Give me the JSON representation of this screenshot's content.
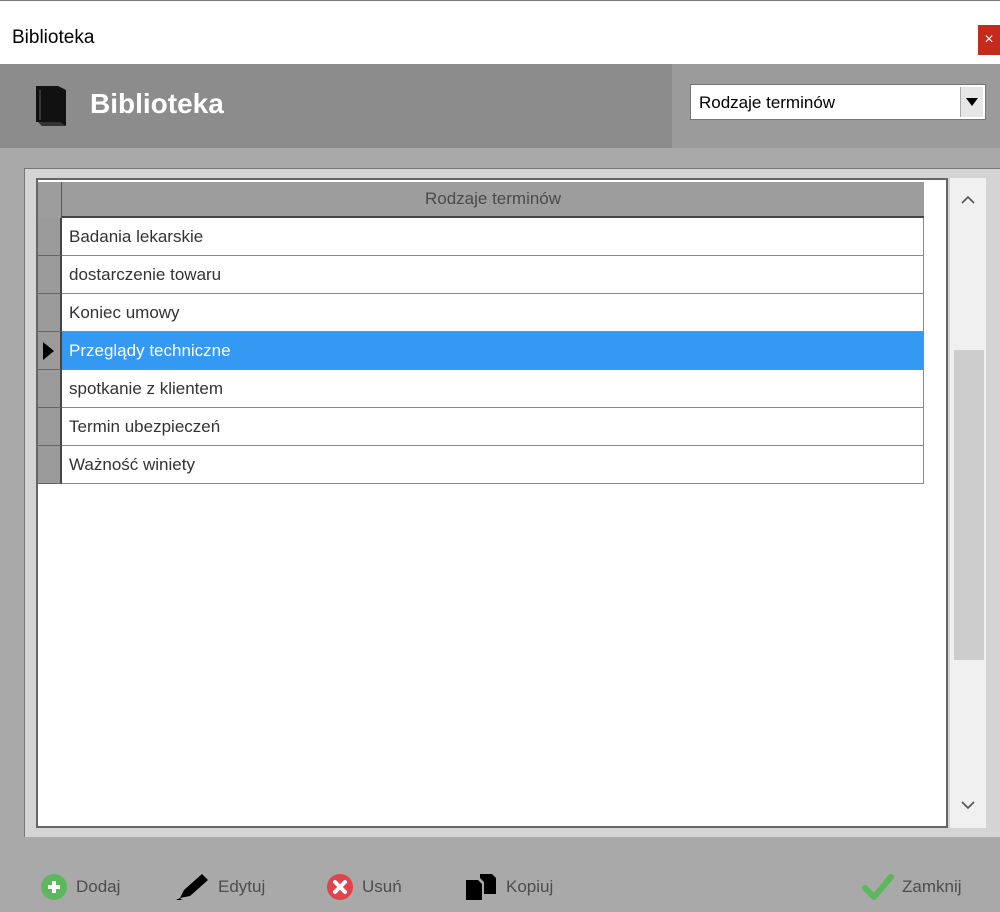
{
  "window": {
    "title": "Biblioteka",
    "close_glyph": "×"
  },
  "header": {
    "icon": "book-icon",
    "heading": "Biblioteka",
    "dropdown": {
      "selected": "Rodzaje terminów",
      "arrow": "▼"
    }
  },
  "grid": {
    "column_header": "Rodzaje terminów",
    "rows": [
      {
        "label": "Badania lekarskie",
        "selected": false
      },
      {
        "label": "dostarczenie towaru",
        "selected": false
      },
      {
        "label": "Koniec umowy",
        "selected": false
      },
      {
        "label": "Przeglądy techniczne",
        "selected": true
      },
      {
        "label": "spotkanie z klientem",
        "selected": false
      },
      {
        "label": "Termin ubezpieczeń",
        "selected": false
      },
      {
        "label": "Ważność winiety",
        "selected": false
      }
    ],
    "selection_color": "#3399f3"
  },
  "scrollbar": {
    "up_glyph": "˄",
    "down_glyph": "˅"
  },
  "toolbar": {
    "add": {
      "label": "Dodaj",
      "icon": "plus-circle-icon",
      "color": "#5cb85c"
    },
    "edit": {
      "label": "Edytuj",
      "icon": "pencil-icon",
      "color": "#000000"
    },
    "delete": {
      "label": "Usuń",
      "icon": "x-circle-icon",
      "color": "#e0434a"
    },
    "copy": {
      "label": "Kopiuj",
      "icon": "copy-icon",
      "color": "#000000"
    },
    "close": {
      "label": "Zamknij",
      "icon": "checkmark-icon",
      "color": "#5cb85c"
    }
  }
}
